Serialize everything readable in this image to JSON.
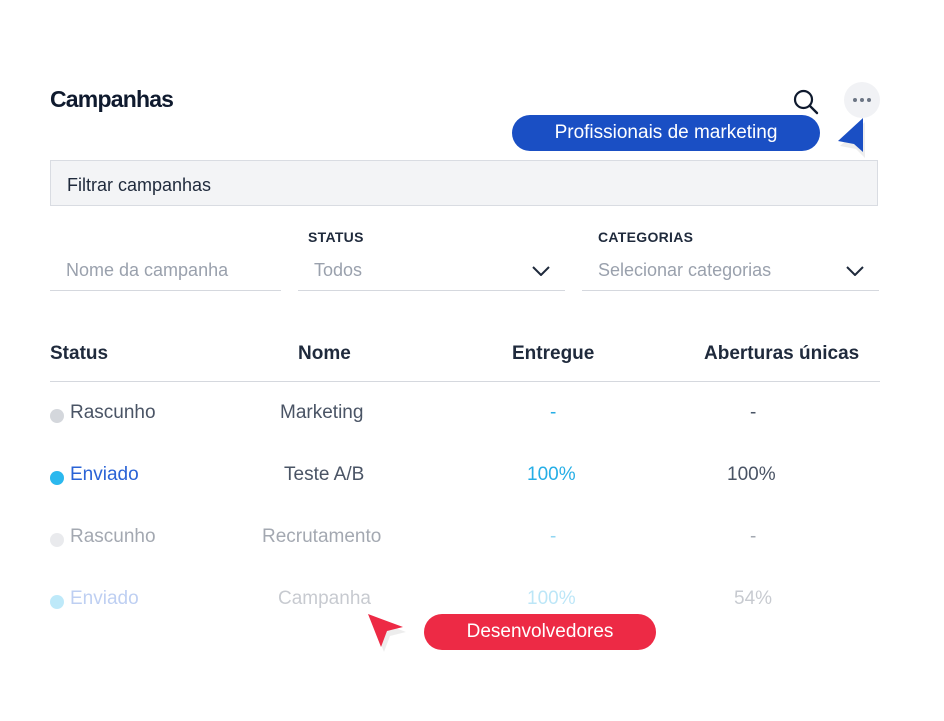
{
  "header": {
    "title": "Campanhas"
  },
  "icons": {
    "search": "search-icon",
    "more": "more-horizontal-icon"
  },
  "callouts": {
    "marketing": "Profissionais de marketing",
    "developers": "Desenvolvedores"
  },
  "filter": {
    "placeholder": "Filtrar campanhas"
  },
  "fields": {
    "name": {
      "label": "",
      "placeholder": "Nome da campanha"
    },
    "status": {
      "label": "STATUS",
      "value": "Todos"
    },
    "categories": {
      "label": "CATEGORIAS",
      "value": "Selecionar categorias"
    }
  },
  "table": {
    "headers": [
      "Status",
      "Nome",
      "Entregue",
      "Aberturas únicas"
    ],
    "rows": [
      {
        "status": "Rascunho",
        "name": "Marketing",
        "delivered": "-",
        "opens": "-"
      },
      {
        "status": "Enviado",
        "name": "Teste A/B",
        "delivered": "100%",
        "opens": "100%"
      },
      {
        "status": "Rascunho",
        "name": "Recrutamento",
        "delivered": "-",
        "opens": "-"
      },
      {
        "status": "Enviado",
        "name": "Campanha",
        "delivered": "100%",
        "opens": "54%"
      }
    ]
  },
  "colors": {
    "marketing_pill": "#1a4fc4",
    "developer_pill": "#ed2a45",
    "sent_blue": "#2a63d6",
    "sent_dot": "#2bb8ee",
    "delivered_cyan": "#25aee6",
    "draft_gray": "#d4d7dc"
  }
}
